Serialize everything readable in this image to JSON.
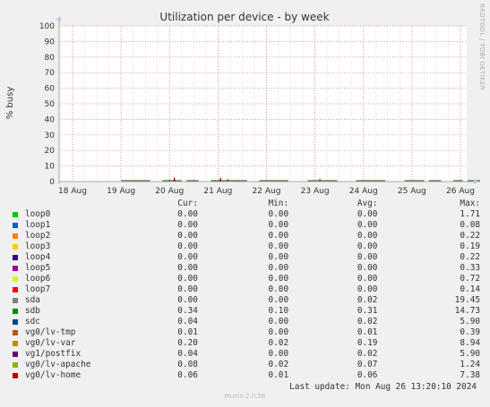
{
  "chart_data": {
    "type": "area",
    "title": "Utilization per device - by week",
    "ylabel": "% busy",
    "ylim": [
      0,
      100
    ],
    "yticks": [
      0,
      10,
      20,
      30,
      40,
      50,
      60,
      70,
      80,
      90,
      100
    ],
    "x_tick_labels": [
      "18 Aug",
      "19 Aug",
      "20 Aug",
      "21 Aug",
      "22 Aug",
      "23 Aug",
      "24 Aug",
      "25 Aug",
      "26 Aug"
    ],
    "grid": true,
    "spikes": [
      {
        "x": 1.3,
        "y": 0.8,
        "color": "#004400"
      },
      {
        "x": 2.0,
        "y": 1.6,
        "color": "#006600"
      },
      {
        "x": 2.1,
        "y": 3.5,
        "color": "#800000"
      },
      {
        "x": 2.5,
        "y": 1.2,
        "color": "#006600"
      },
      {
        "x": 2.95,
        "y": 1.0,
        "color": "#004400"
      },
      {
        "x": 3.05,
        "y": 3.2,
        "color": "#800000"
      },
      {
        "x": 3.2,
        "y": 2.0,
        "color": "#800000"
      },
      {
        "x": 3.4,
        "y": 1.2,
        "color": "#006600"
      },
      {
        "x": 4.15,
        "y": 0.9,
        "color": "#006600"
      },
      {
        "x": 5.1,
        "y": 2.2,
        "color": "#800000"
      },
      {
        "x": 5.45,
        "y": 0.8,
        "color": "#006600"
      },
      {
        "x": 6.1,
        "y": 1.0,
        "color": "#006600"
      },
      {
        "x": 6.9,
        "y": 0.6,
        "color": "#006600"
      },
      {
        "x": 7.55,
        "y": 0.8,
        "color": "#006600"
      },
      {
        "x": 8.2,
        "y": 1.0,
        "color": "#006600"
      }
    ],
    "band_segments": [
      [
        1.0,
        1.6
      ],
      [
        1.85,
        2.25
      ],
      [
        2.35,
        2.6
      ],
      [
        2.85,
        3.6
      ],
      [
        3.85,
        4.45
      ],
      [
        4.85,
        5.45
      ],
      [
        5.85,
        6.45
      ],
      [
        6.85,
        7.25
      ],
      [
        7.35,
        7.6
      ],
      [
        7.85,
        8.05
      ],
      [
        8.15,
        8.4
      ]
    ],
    "band_color": "#4a6b2a"
  },
  "header": {
    "side_label": "RRDTOOL / TOBI OETIKER"
  },
  "legend": {
    "col_cur": "Cur:",
    "col_min": "Min:",
    "col_avg": "Avg:",
    "col_max": "Max:",
    "rows": [
      {
        "name": "loop0",
        "color": "#00cc00",
        "cur": "0.00",
        "min": "0.00",
        "avg": "0.00",
        "max": "1.71"
      },
      {
        "name": "loop1",
        "color": "#0066b3",
        "cur": "0.00",
        "min": "0.00",
        "avg": "0.00",
        "max": "0.08"
      },
      {
        "name": "loop2",
        "color": "#ff8000",
        "cur": "0.00",
        "min": "0.00",
        "avg": "0.00",
        "max": "0.22"
      },
      {
        "name": "loop3",
        "color": "#ffcc00",
        "cur": "0.00",
        "min": "0.00",
        "avg": "0.00",
        "max": "0.19"
      },
      {
        "name": "loop4",
        "color": "#330099",
        "cur": "0.00",
        "min": "0.00",
        "avg": "0.00",
        "max": "0.22"
      },
      {
        "name": "loop5",
        "color": "#990099",
        "cur": "0.00",
        "min": "0.00",
        "avg": "0.00",
        "max": "0.33"
      },
      {
        "name": "loop6",
        "color": "#ccff00",
        "cur": "0.00",
        "min": "0.00",
        "avg": "0.00",
        "max": "0.72"
      },
      {
        "name": "loop7",
        "color": "#ff0000",
        "cur": "0.00",
        "min": "0.00",
        "avg": "0.00",
        "max": "0.14"
      },
      {
        "name": "sda",
        "color": "#808080",
        "cur": "0.00",
        "min": "0.00",
        "avg": "0.02",
        "max": "19.45"
      },
      {
        "name": "sdb",
        "color": "#008f00",
        "cur": "0.34",
        "min": "0.10",
        "avg": "0.31",
        "max": "14.73"
      },
      {
        "name": "sdc",
        "color": "#00487d",
        "cur": "0.04",
        "min": "0.00",
        "avg": "0.02",
        "max": "5.90"
      },
      {
        "name": "vg0/lv-tmp",
        "color": "#b35a00",
        "cur": "0.01",
        "min": "0.00",
        "avg": "0.01",
        "max": "0.39"
      },
      {
        "name": "vg0/lv-var",
        "color": "#b38f00",
        "cur": "0.20",
        "min": "0.02",
        "avg": "0.19",
        "max": "8.94"
      },
      {
        "name": "vg1/postfix",
        "color": "#6b006b",
        "cur": "0.04",
        "min": "0.00",
        "avg": "0.02",
        "max": "5.90"
      },
      {
        "name": "vg0/lv-apache",
        "color": "#8fb300",
        "cur": "0.08",
        "min": "0.02",
        "avg": "0.07",
        "max": "1.24"
      },
      {
        "name": "vg0/lv-home",
        "color": "#b30000",
        "cur": "0.06",
        "min": "0.01",
        "avg": "0.06",
        "max": "7.38"
      }
    ]
  },
  "footer": {
    "last_update": "Last update: Mon Aug 26 13:20:10 2024",
    "munin_version": "Munin 2.0.56"
  }
}
